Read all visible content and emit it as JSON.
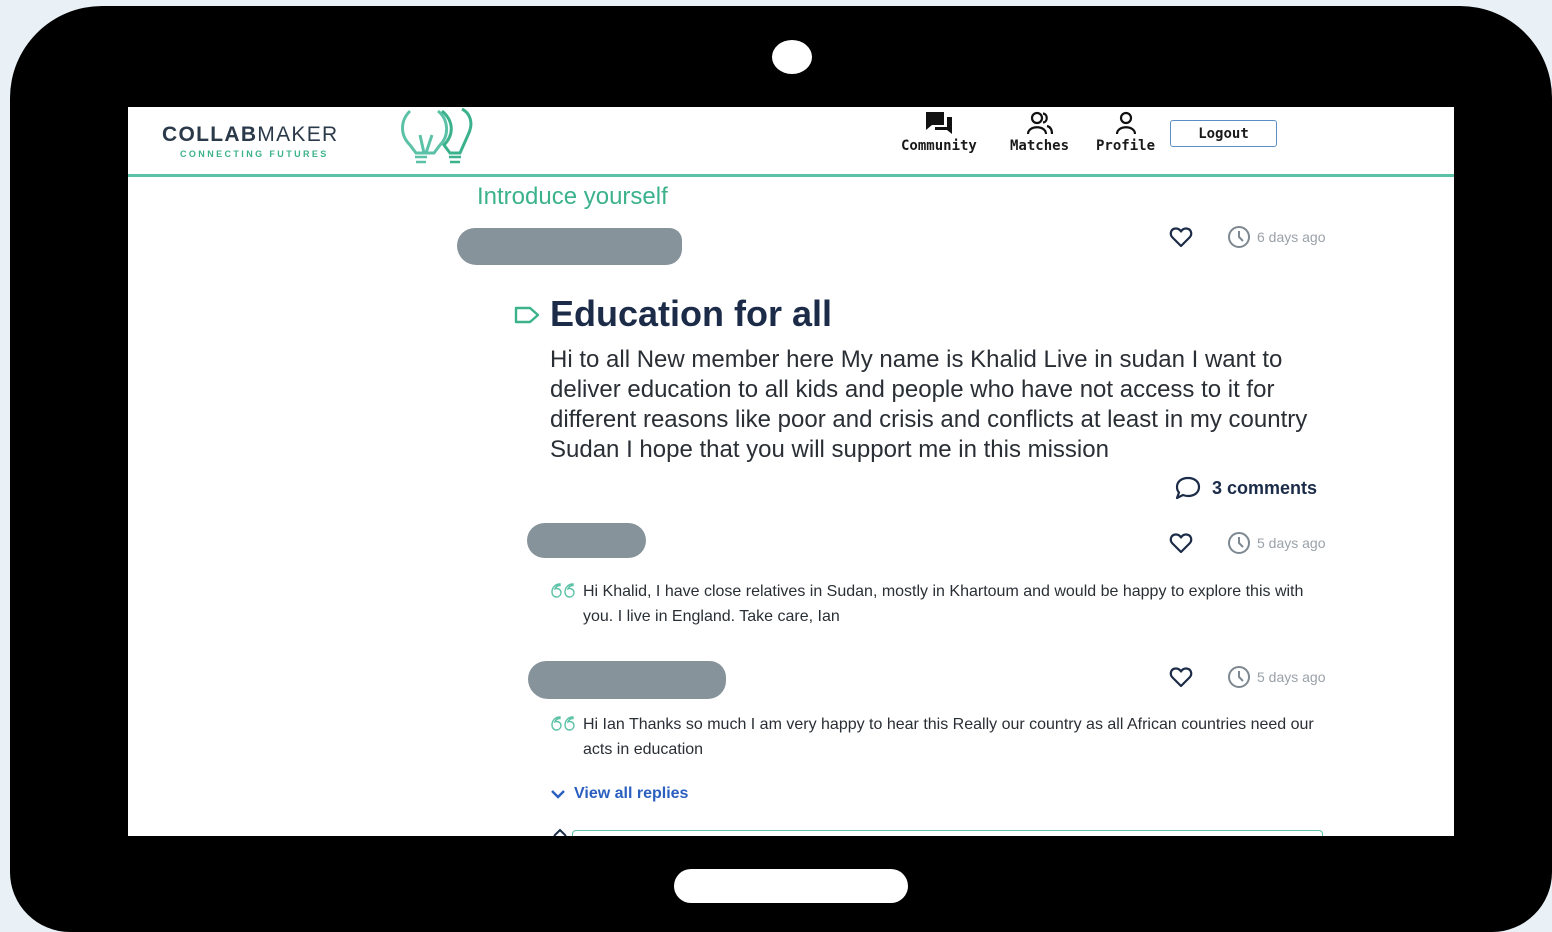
{
  "header": {
    "logo_bold": "COLLAB",
    "logo_light": "MAKER",
    "logo_tagline": "CONNECTING FUTURES",
    "nav": [
      {
        "label": "Community",
        "icon": "chat-bubbles-icon"
      },
      {
        "label": "Matches",
        "icon": "users-icon"
      },
      {
        "label": "Profile",
        "icon": "user-icon"
      }
    ],
    "logout_label": "Logout"
  },
  "category": "Introduce yourself",
  "post": {
    "time": "6 days ago",
    "title": "Education for all",
    "body": "Hi to all New member here My name is Khalid Live in sudan I want to deliver education to all kids and people who have not access to it for different reasons like poor and crisis and conflicts at least in my country Sudan I hope that you will support me in this mission",
    "comments_label": "3 comments"
  },
  "comments": [
    {
      "time": "5 days ago",
      "text": "Hi Khalid, I have close relatives in Sudan, mostly in Khartoum and would be happy to explore this with you. I live in England. Take care, Ian"
    },
    {
      "time": "5 days ago",
      "text": "Hi Ian Thanks so much I am very happy to hear this Really our country as all African countries need our acts in education"
    }
  ],
  "view_replies_label": "View all replies",
  "colors": {
    "accent": "#3bb28c",
    "title": "#1b2b48",
    "link": "#2a5fc0",
    "redaction": "#87939b"
  }
}
